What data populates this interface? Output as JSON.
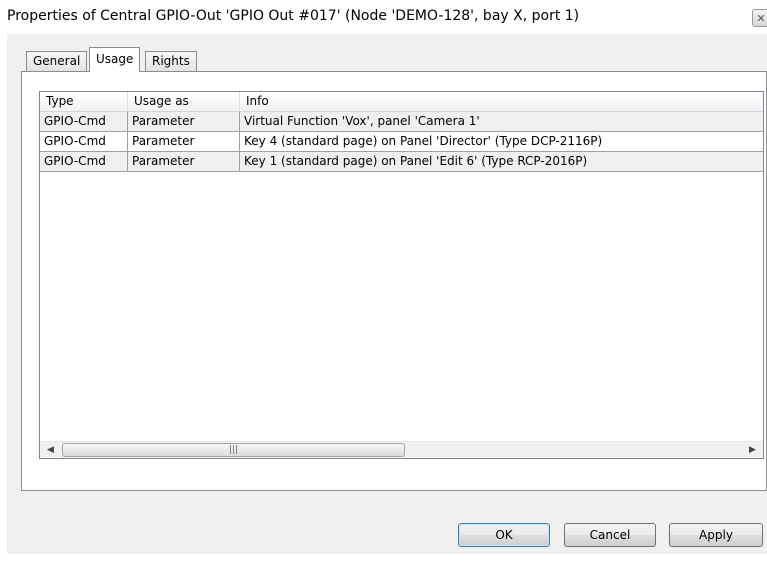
{
  "window": {
    "title": "Properties of Central GPIO-Out 'GPIO Out #017' (Node 'DEMO-128', bay X, port 1)",
    "close_glyph": "✕"
  },
  "tabs": [
    {
      "label": "General",
      "active": false
    },
    {
      "label": "Usage",
      "active": true
    },
    {
      "label": "Rights",
      "active": false
    }
  ],
  "usage_list": {
    "columns": [
      "Type",
      "Usage as",
      "Info"
    ],
    "rows": [
      [
        "GPIO-Cmd",
        "Parameter",
        "Virtual Function 'Vox', panel 'Camera 1'"
      ],
      [
        "GPIO-Cmd",
        "Parameter",
        "Key 4 (standard page) on Panel 'Director' (Type DCP-2116P)"
      ],
      [
        "GPIO-Cmd",
        "Parameter",
        "Key 1 (standard page) on Panel 'Edit 6' (Type RCP-2016P)"
      ]
    ],
    "scrollbar": {
      "left_arrow": "◀",
      "right_arrow": "▶",
      "thumb_grip": "|||"
    }
  },
  "buttons": {
    "ok": "OK",
    "cancel": "Cancel",
    "apply": "Apply"
  }
}
